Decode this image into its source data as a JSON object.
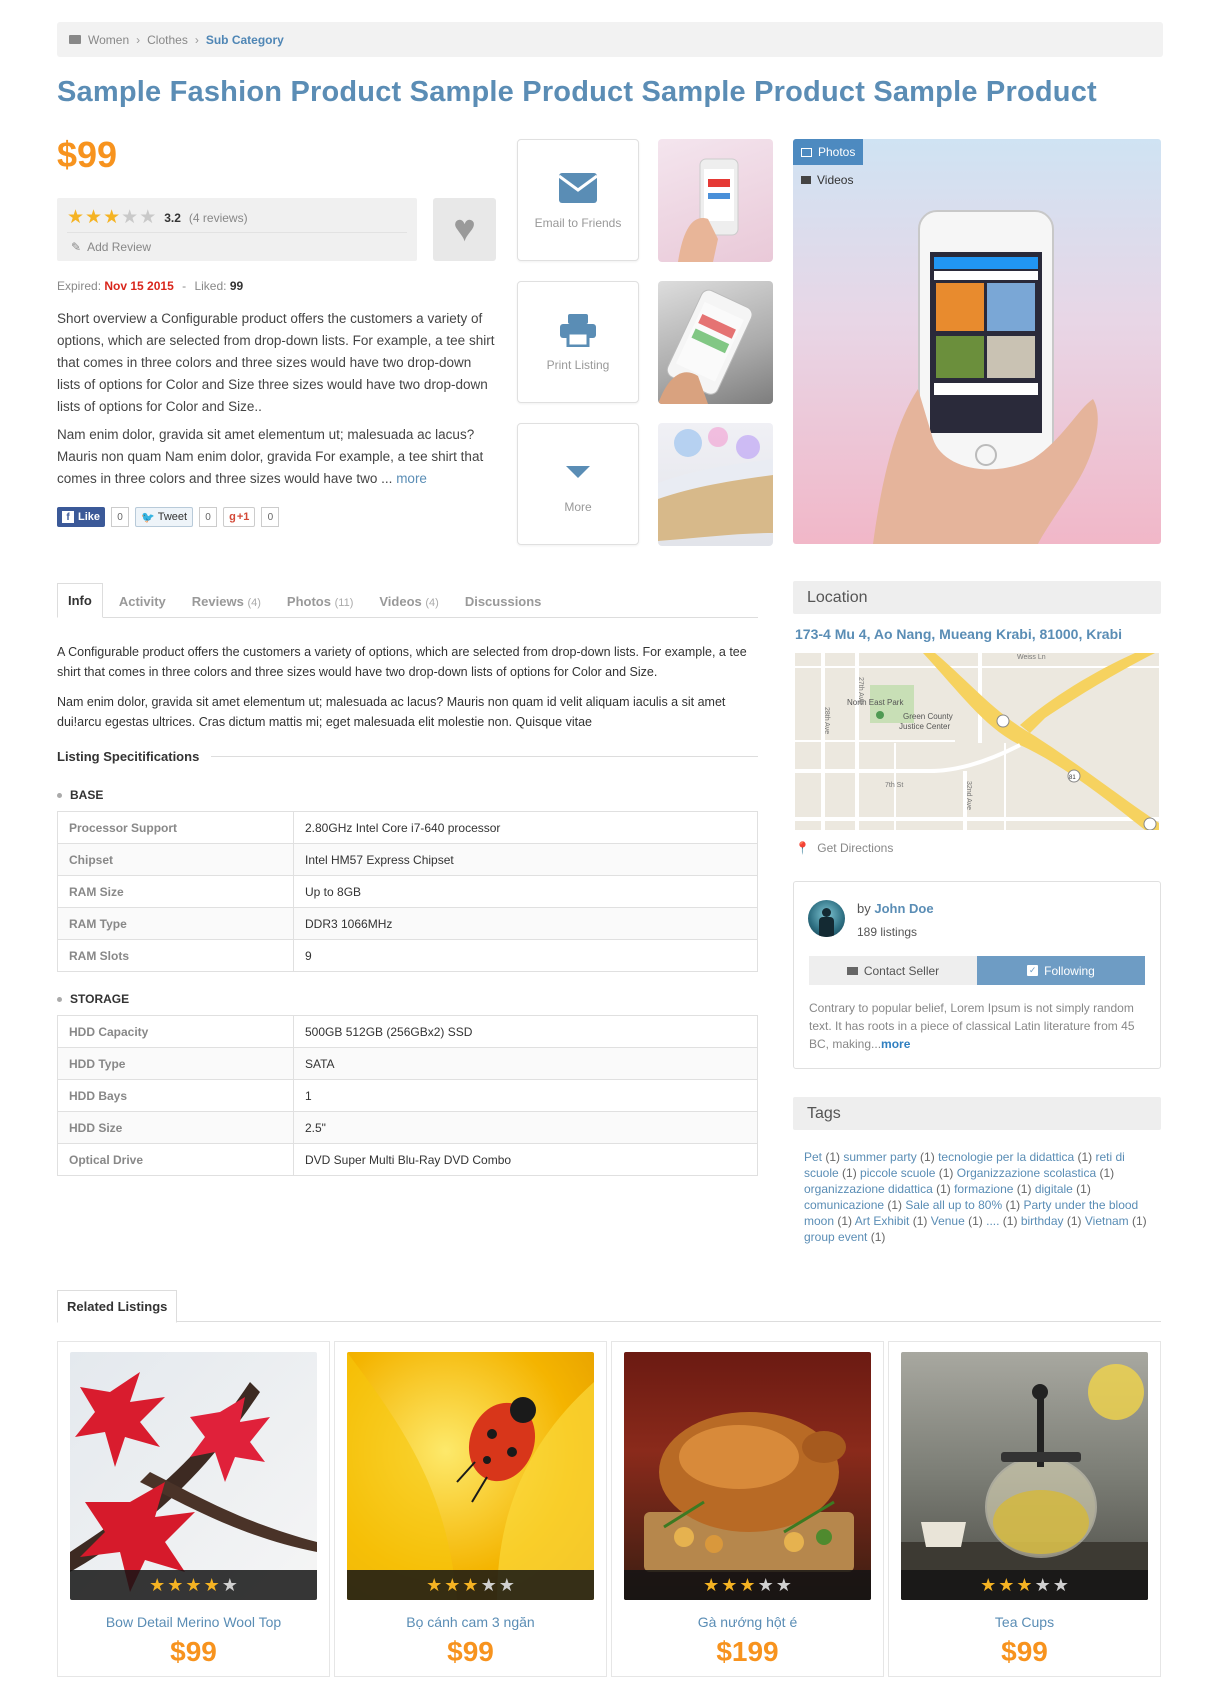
{
  "breadcrumb": {
    "items": [
      "Women",
      "Clothes"
    ],
    "current": "Sub Category"
  },
  "product": {
    "title": "Sample Fashion Product Sample Product Sample Product Sample Product",
    "price": "$99",
    "rating": 3.2,
    "rating_text": "3.2",
    "reviews_text": "(4 reviews)",
    "add_review": "Add Review",
    "expired_label": "Expired:",
    "expired_date": "Nov 15 2015",
    "liked_label": "Liked:",
    "liked_count": "99",
    "overview_1": "Short overview a Configurable product offers the customers a variety of options, which are selected from drop-down lists. For example, a tee shirt that comes in three colors and three sizes would have two drop-down lists of options for Color and Size three sizes would have two drop-down lists of options for Color and Size..",
    "overview_2": "Nam enim dolor, gravida sit amet elementum ut; malesuada ac lacus? Mauris non quam Nam enim dolor, gravida For example, a tee shirt that comes in three colors and three sizes would have two ...",
    "more_link": "more"
  },
  "social": {
    "like_label": "Like",
    "like_count": "0",
    "tweet_label": "Tweet",
    "tweet_count": "0",
    "gplus_label": "+1",
    "gplus_count": "0"
  },
  "actions": {
    "email": "Email to Friends",
    "print": "Print Listing",
    "more": "More"
  },
  "media": {
    "photos_tab": "Photos",
    "videos_tab": "Videos"
  },
  "tabs": [
    {
      "label": "Info",
      "count": ""
    },
    {
      "label": "Activity",
      "count": ""
    },
    {
      "label": "Reviews",
      "count": "(4)"
    },
    {
      "label": "Photos",
      "count": "(11)"
    },
    {
      "label": "Videos",
      "count": "(4)"
    },
    {
      "label": "Discussions",
      "count": ""
    }
  ],
  "info": {
    "p1": "A Configurable product offers the customers a variety of options, which are selected from drop-down lists. For example, a tee shirt that comes in three colors and three sizes would have two drop-down lists of options for Color and Size.",
    "p2": "Nam enim dolor, gravida sit amet elementum ut; malesuada ac lacus? Mauris non quam id velit aliquam iaculis a sit amet dui!arcu egestas ultrices. Cras dictum mattis mi; eget malesuada elit molestie non. Quisque vitae",
    "spec_title": "Listing Specitifications"
  },
  "specs": {
    "base_title": "BASE",
    "base": [
      [
        "Processor Support",
        "2.80GHz Intel Core i7-640 processor"
      ],
      [
        "Chipset",
        "Intel HM57 Express Chipset"
      ],
      [
        "RAM Size",
        "Up to 8GB"
      ],
      [
        "RAM Type",
        "DDR3 1066MHz"
      ],
      [
        "RAM Slots",
        "9"
      ]
    ],
    "storage_title": "STORAGE",
    "storage": [
      [
        "HDD Capacity",
        "500GB 512GB (256GBx2) SSD"
      ],
      [
        "HDD Type",
        "SATA"
      ],
      [
        "HDD Bays",
        "1"
      ],
      [
        "HDD Size",
        "2.5\""
      ],
      [
        "Optical Drive",
        "DVD Super Multi Blu-Ray DVD Combo"
      ]
    ]
  },
  "location": {
    "title": "Location",
    "address": "173-4 Mu 4, Ao Nang, Mueang Krabi, 81000, Krabi",
    "directions": "Get Directions",
    "map_labels": {
      "park": "North East Park",
      "center1": "Green County",
      "center2": "Justice Center",
      "st1": "Weiss Ln",
      "st2": "7th St",
      "st3": "27th Ave",
      "st4": "28th Ave",
      "st5": "32nd Ave",
      "hwy": "81"
    }
  },
  "seller": {
    "by": "by",
    "name": "John Doe",
    "listings": "189 listings",
    "contact": "Contact Seller",
    "following": "Following",
    "bio": "Contrary to popular belief, Lorem Ipsum is not simply random text. It has roots in a piece of classical Latin literature from 45 BC, making...",
    "bio_more": "more"
  },
  "tags": {
    "title": "Tags",
    "items": [
      [
        "Pet",
        "1"
      ],
      [
        "summer party",
        "1"
      ],
      [
        "tecnologie per la didattica",
        "1"
      ],
      [
        "reti di scuole",
        "1"
      ],
      [
        "piccole scuole",
        "1"
      ],
      [
        "Organizzazione scolastica",
        "1"
      ],
      [
        "organizzazione didattica",
        "1"
      ],
      [
        "formazione",
        "1"
      ],
      [
        "digitale",
        "1"
      ],
      [
        "comunicazione",
        "1"
      ],
      [
        "Sale all up to 80%",
        "1"
      ],
      [
        "Party under the blood moon",
        "1"
      ],
      [
        "Art Exhibit",
        "1"
      ],
      [
        "Venue",
        "1"
      ],
      [
        "....",
        "1"
      ],
      [
        "birthday",
        "1"
      ],
      [
        "Vietnam",
        "1"
      ],
      [
        "group event",
        "1"
      ]
    ]
  },
  "related": {
    "title": "Related Listings",
    "items": [
      {
        "title": "Bow Detail Merino Wool Top",
        "price": "$99",
        "rating": 4
      },
      {
        "title": "Bọ cánh cam 3 ngăn",
        "price": "$99",
        "rating": 3
      },
      {
        "title": "Gà nướng hột é",
        "price": "$199",
        "rating": 3
      },
      {
        "title": "Tea Cups",
        "price": "$99",
        "rating": 3
      }
    ]
  },
  "colors": {
    "accent": "#5a8db5",
    "price": "#f7931e",
    "star": "#f5b323",
    "expired": "#d9261c",
    "photo_tab": "#4d8ac0",
    "following": "#6e9cc4"
  }
}
